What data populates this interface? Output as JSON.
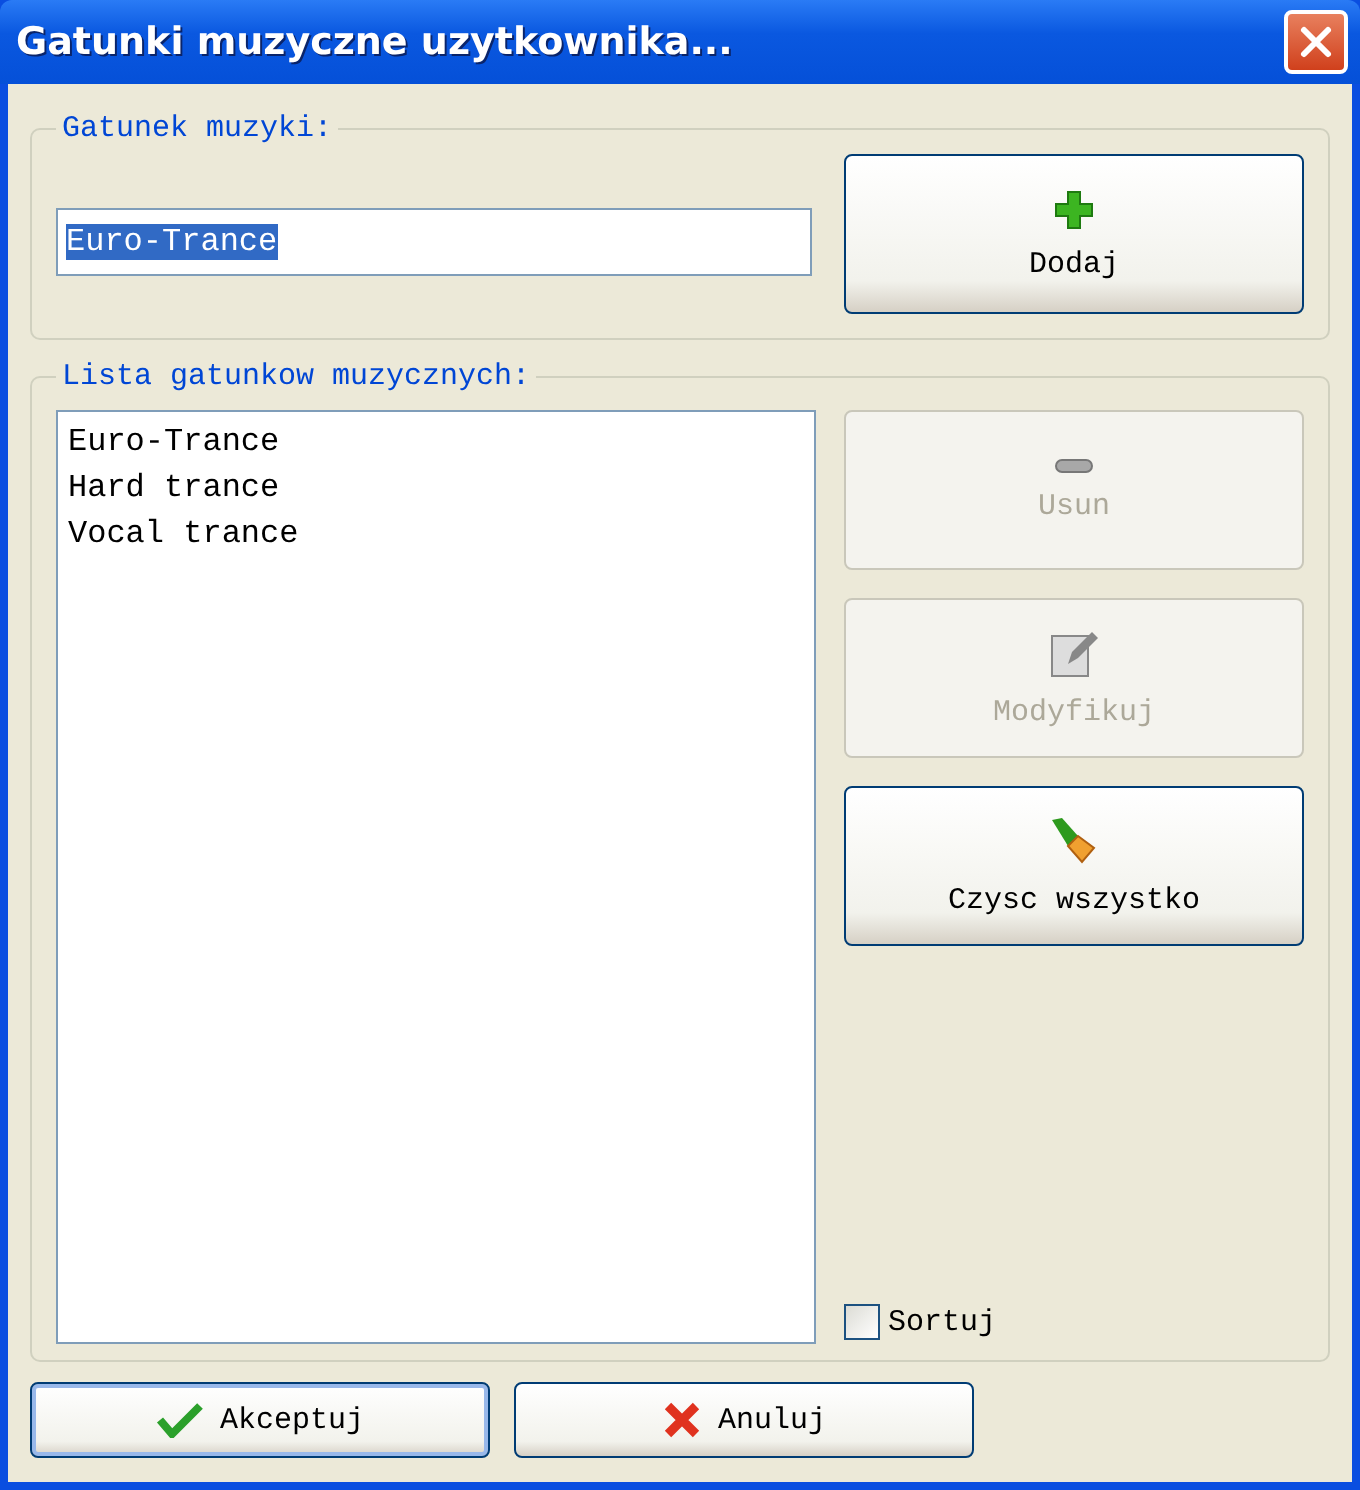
{
  "window": {
    "title": "Gatunki muzyczne uzytkownika..."
  },
  "genre_group": {
    "label": "Gatunek muzyki:",
    "input": {
      "value": "Euro-Trance",
      "selected": true
    },
    "add_button": {
      "label": "Dodaj",
      "kind": "plus",
      "disabled": false
    }
  },
  "list_group": {
    "label": "Lista gatunkow muzycznych:",
    "items": [
      {
        "text": "Euro-Trance"
      },
      {
        "text": "Hard trance"
      },
      {
        "text": "Vocal trance"
      }
    ],
    "buttons": [
      {
        "label": "Usun",
        "kind": "minus",
        "disabled": true
      },
      {
        "label": "Modyfikuj",
        "kind": "edit",
        "disabled": true
      },
      {
        "label": "Czysc wszystko",
        "kind": "brush",
        "disabled": false
      }
    ],
    "sort": {
      "label": "Sortuj",
      "checked": false
    }
  },
  "footer_buttons": [
    {
      "label": "Akceptuj",
      "kind": "check",
      "default": true
    },
    {
      "label": "Anuluj",
      "kind": "cross",
      "default": false
    }
  ]
}
